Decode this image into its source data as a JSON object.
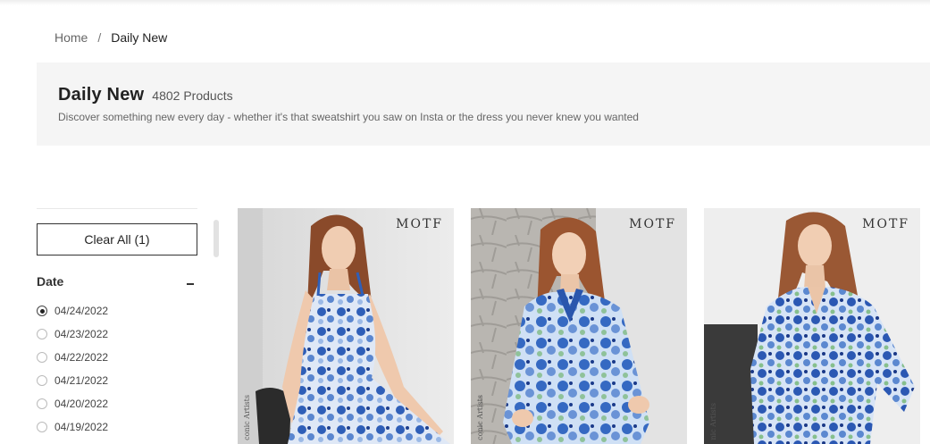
{
  "breadcrumb": {
    "home": "Home",
    "separator": "/",
    "current": "Daily New"
  },
  "hero": {
    "title": "Daily New",
    "count": "4802 Products",
    "description": "Discover something new every day - whether it's that sweatshirt you saw on Insta or the dress you never knew you wanted"
  },
  "filters": {
    "clear_all": "Clear All (1)",
    "date_label": "Date",
    "collapse_icon": "minus-icon",
    "dates": [
      {
        "label": "04/24/2022",
        "selected": true
      },
      {
        "label": "04/23/2022",
        "selected": false
      },
      {
        "label": "04/22/2022",
        "selected": false
      },
      {
        "label": "04/21/2022",
        "selected": false
      },
      {
        "label": "04/20/2022",
        "selected": false
      },
      {
        "label": "04/19/2022",
        "selected": false
      }
    ]
  },
  "products": [
    {
      "brand": "MOTF",
      "side_text": "conic Artists",
      "image": "woman-blue-floral-slip-dress"
    },
    {
      "brand": "MOTF",
      "side_text": "conic Artists",
      "image": "woman-blue-floral-satin-shirt"
    },
    {
      "brand": "MOTF",
      "side_text": "nic Artists",
      "image": "woman-blue-floral-blouse"
    }
  ],
  "colors": {
    "hero_bg": "#f5f5f5",
    "print_blue": "#2f5fb8",
    "print_light": "#d9e6f7"
  }
}
